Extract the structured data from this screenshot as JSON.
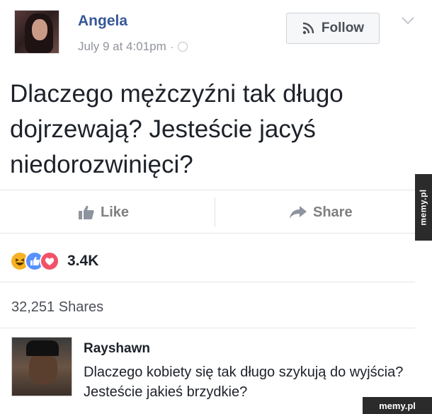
{
  "post": {
    "author": "Angela",
    "timestamp": "July 9 at 4:01pm",
    "follow_label": "Follow",
    "text": "Dlaczego mężczyźni tak długo dojrzewają? Jesteście jacyś niedorozwinięci?",
    "icons": {
      "follow": "rss-icon",
      "menu": "chevron-down-icon",
      "privacy": "globe-icon"
    }
  },
  "actions": {
    "like_label": "Like",
    "share_label": "Share",
    "icons": {
      "like": "thumbs-up-icon",
      "share": "share-arrow-icon"
    }
  },
  "reactions": {
    "types": [
      "haha",
      "like",
      "love"
    ],
    "count": "3.4K",
    "colors": {
      "haha": "#f7b125",
      "like": "#5890ff",
      "love": "#f25268"
    }
  },
  "shares": {
    "text": "32,251 Shares"
  },
  "comment": {
    "author": "Rayshawn",
    "text": "Dlaczego kobiety się tak długo szykują do wyjścia? Jesteście jakieś brzydkie?"
  },
  "watermarks": {
    "side": "memy.pl",
    "corner": "memy.pl"
  },
  "colors": {
    "link_blue": "#365899",
    "text": "#1d2129",
    "muted": "#90949c"
  }
}
